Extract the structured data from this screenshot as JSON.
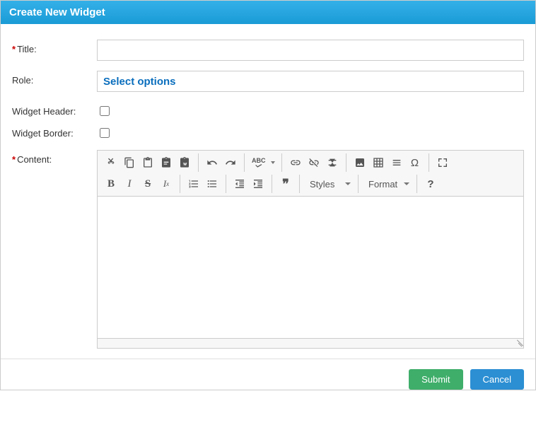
{
  "dialog": {
    "title": "Create New Widget"
  },
  "labels": {
    "title": "Title:",
    "role": "Role:",
    "widget_header": "Widget Header:",
    "widget_border": "Widget Border:",
    "content": "Content:"
  },
  "role": {
    "placeholder": "Select options"
  },
  "editor": {
    "styles_label": "Styles",
    "format_label": "Format",
    "abc_label": "ABC",
    "bold": "B",
    "italic": "I",
    "strike": "S",
    "removefmt": "Iₓ",
    "omega": "Ω",
    "help": "?",
    "quotes": "❞"
  },
  "buttons": {
    "submit": "Submit",
    "cancel": "Cancel"
  }
}
